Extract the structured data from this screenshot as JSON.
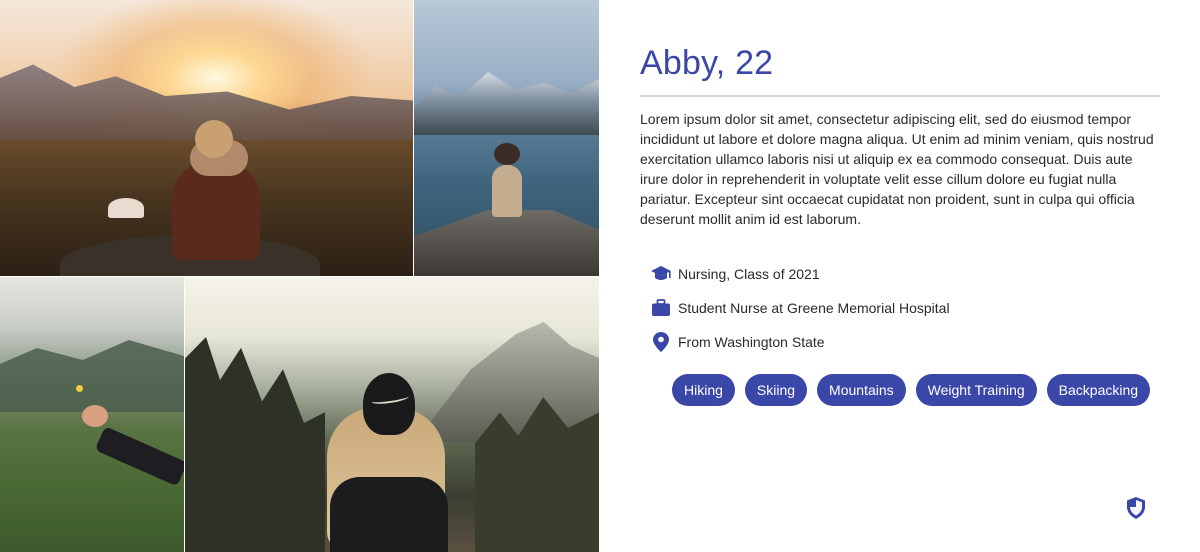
{
  "profile": {
    "name_age": "Abby, 22",
    "bio": "Lorem ipsum dolor sit amet, consectetur adipiscing elit, sed do eiusmod tempor incididunt ut labore et dolore magna aliqua. Ut enim ad minim veniam, quis nostrud exercitation ullamco laboris nisi ut aliquip ex ea commodo consequat. Duis aute irure dolor in reprehenderit in voluptate velit esse cillum dolore eu fugiat nulla pariatur. Excepteur sint occaecat cupidatat non proident, sunt in culpa qui officia deserunt mollit anim id est laborum.",
    "facts": [
      {
        "icon": "graduation-cap-icon",
        "text": "Nursing, Class of 2021"
      },
      {
        "icon": "briefcase-icon",
        "text": "Student Nurse at Greene Memorial Hospital"
      },
      {
        "icon": "map-pin-icon",
        "text": "From Washington State"
      }
    ],
    "interests": [
      "Hiking",
      "Skiing",
      "Mountains",
      "Weight Training",
      "Backpacking"
    ]
  },
  "photos": [
    {
      "name": "photo-sunset-mountain"
    },
    {
      "name": "photo-lake-dock"
    },
    {
      "name": "photo-hills-flower"
    },
    {
      "name": "photo-forest-cap"
    }
  ],
  "footer": {
    "icon": "shield-icon"
  },
  "colors": {
    "accent": "#3a47a8",
    "divider": "#d6d6d6",
    "text": "#2a2a2a"
  }
}
